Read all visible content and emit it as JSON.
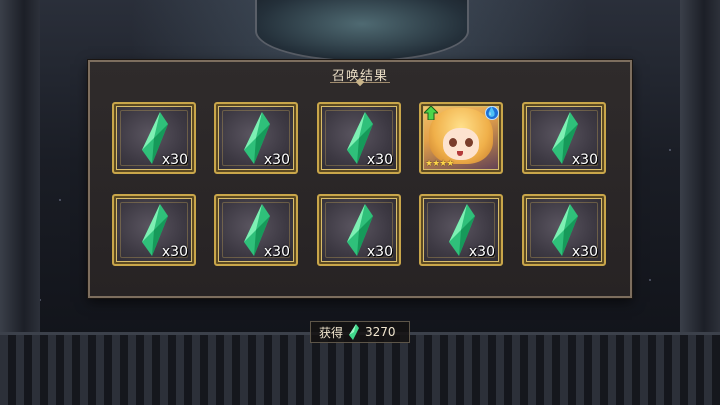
{
  "panel": {
    "title": "召唤结果"
  },
  "rewards": [
    {
      "type": "crystal",
      "quantity": "x30"
    },
    {
      "type": "crystal",
      "quantity": "x30"
    },
    {
      "type": "crystal",
      "quantity": "x30"
    },
    {
      "type": "character",
      "rarity_stars": "★★★★",
      "element_icon": "water-drop-icon",
      "badge_icon": "up-arrow-icon"
    },
    {
      "type": "crystal",
      "quantity": "x30"
    },
    {
      "type": "crystal",
      "quantity": "x30"
    },
    {
      "type": "crystal",
      "quantity": "x30"
    },
    {
      "type": "crystal",
      "quantity": "x30"
    },
    {
      "type": "crystal",
      "quantity": "x30"
    },
    {
      "type": "crystal",
      "quantity": "x30"
    }
  ],
  "obtained": {
    "label": "获得",
    "value": "3270",
    "icon": "green-crystal-icon"
  },
  "colors": {
    "crystal": "#3fd78a",
    "frame_gold": "#c9a64a",
    "panel_border": "#7d6e5e"
  }
}
